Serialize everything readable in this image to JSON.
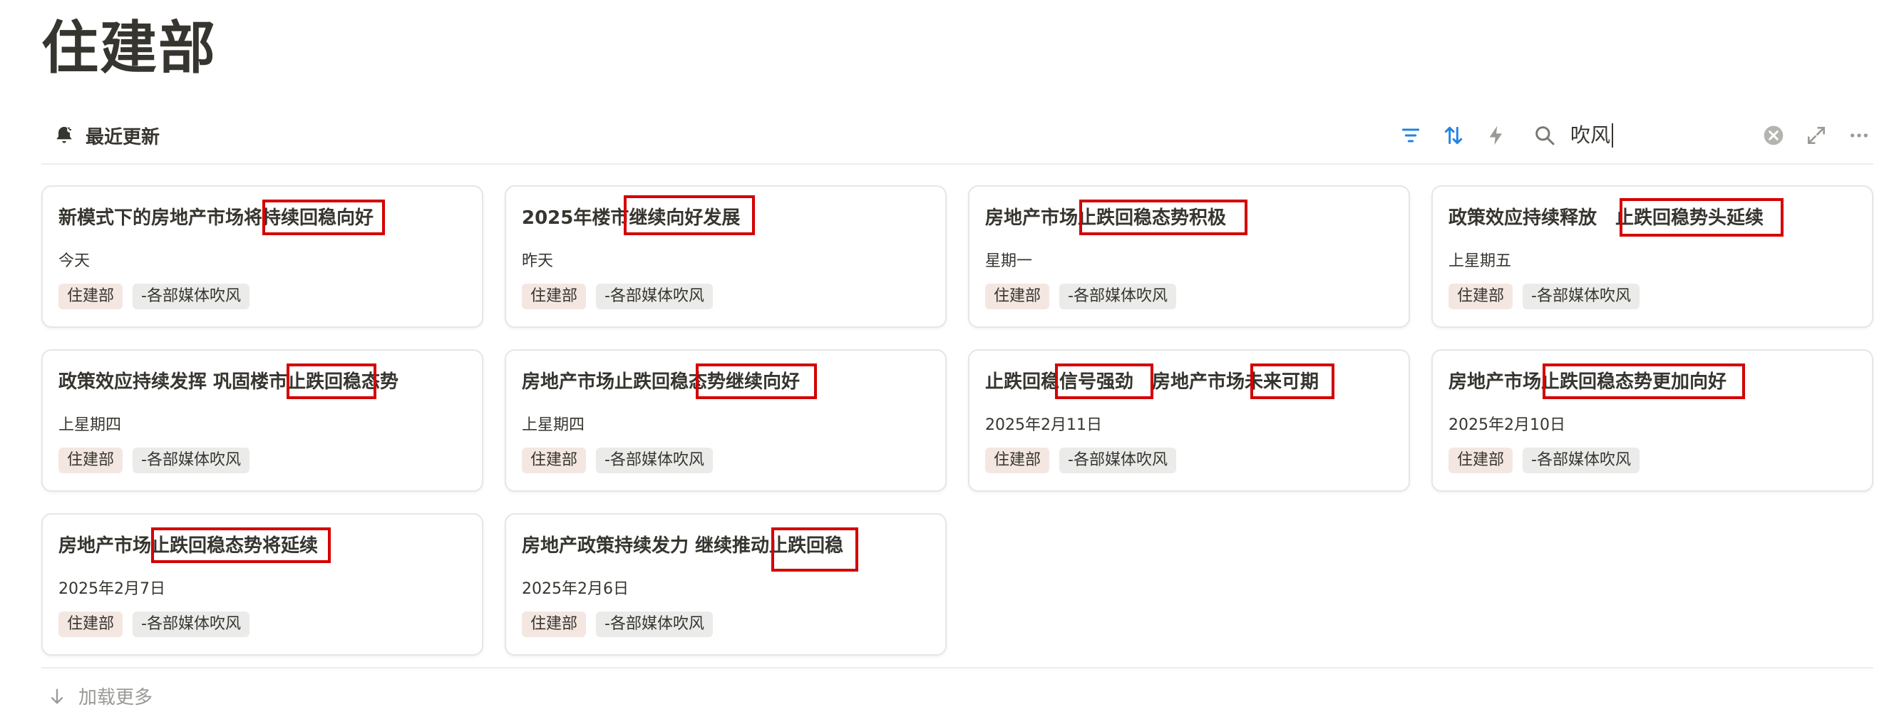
{
  "page": {
    "title": "住建部"
  },
  "view": {
    "label": "最近更新",
    "icon": "bell-icon"
  },
  "toolbar": {
    "icons": [
      "filter-icon",
      "sort-icon",
      "lightning-icon",
      "search-icon",
      "clear-icon",
      "expand-icon",
      "more-icon"
    ],
    "search_value": "吹风",
    "accent": "#2383e2"
  },
  "cards": [
    {
      "title": "新模式下的房地产市场将持续回稳向好",
      "date": "今天",
      "tags": [
        "住建部",
        "-各部媒体吹风"
      ]
    },
    {
      "title": "2025年楼市继续向好发展",
      "date": "昨天",
      "tags": [
        "住建部",
        "-各部媒体吹风"
      ]
    },
    {
      "title": "房地产市场止跌回稳态势积极",
      "date": "星期一",
      "tags": [
        "住建部",
        "-各部媒体吹风"
      ]
    },
    {
      "title": "政策效应持续释放　止跌回稳势头延续",
      "date": "上星期五",
      "tags": [
        "住建部",
        "-各部媒体吹风"
      ]
    },
    {
      "title": "政策效应持续发挥 巩固楼市止跌回稳态势",
      "date": "上星期四",
      "tags": [
        "住建部",
        "-各部媒体吹风"
      ]
    },
    {
      "title": "房地产市场止跌回稳态势继续向好",
      "date": "上星期四",
      "tags": [
        "住建部",
        "-各部媒体吹风"
      ]
    },
    {
      "title": "止跌回稳信号强劲　房地产市场未来可期",
      "date": "2025年2月11日",
      "tags": [
        "住建部",
        "-各部媒体吹风"
      ]
    },
    {
      "title": "房地产市场止跌回稳态势更加向好",
      "date": "2025年2月10日",
      "tags": [
        "住建部",
        "-各部媒体吹风"
      ]
    },
    {
      "title": "房地产市场止跌回稳态势将延续",
      "date": "2025年2月7日",
      "tags": [
        "住建部",
        "-各部媒体吹风"
      ]
    },
    {
      "title": "房地产政策持续发力 继续推动止跌回稳",
      "date": "2025年2月6日",
      "tags": [
        "住建部",
        "-各部媒体吹风"
      ]
    }
  ],
  "footer": {
    "load_more": "加载更多"
  },
  "colors": {
    "highlight": "#d40000",
    "tag_primary": "#f4e7e2",
    "tag_secondary": "#ebebea"
  }
}
